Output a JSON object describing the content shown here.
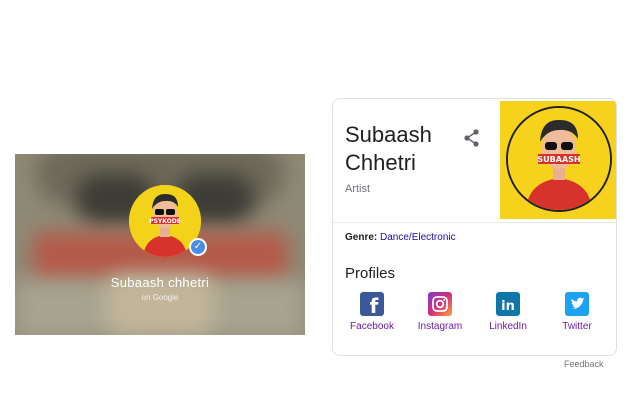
{
  "banner": {
    "name": "Subaash chhetri",
    "subtitle": "on Google",
    "avatar_label": "PSYKODE",
    "verified_icon": "check-icon"
  },
  "card": {
    "title_line1": "Subaash",
    "title_line2": "Chhetri",
    "subtitle": "Artist",
    "share_icon": "share-icon",
    "image_label": "SUBAASH",
    "genre_label": "Genre:",
    "genre_value": "Dance/Electronic",
    "profiles_heading": "Profiles",
    "profiles": [
      {
        "name": "Facebook",
        "icon": "facebook-icon",
        "color": "#3b5998"
      },
      {
        "name": "Instagram",
        "icon": "instagram-icon",
        "color": "#c13584"
      },
      {
        "name": "LinkedIn",
        "icon": "linkedin-icon",
        "color": "#0e76a8"
      },
      {
        "name": "Twitter",
        "icon": "twitter-icon",
        "color": "#1da1f2"
      }
    ]
  },
  "footer": {
    "feedback_label": "Feedback"
  }
}
